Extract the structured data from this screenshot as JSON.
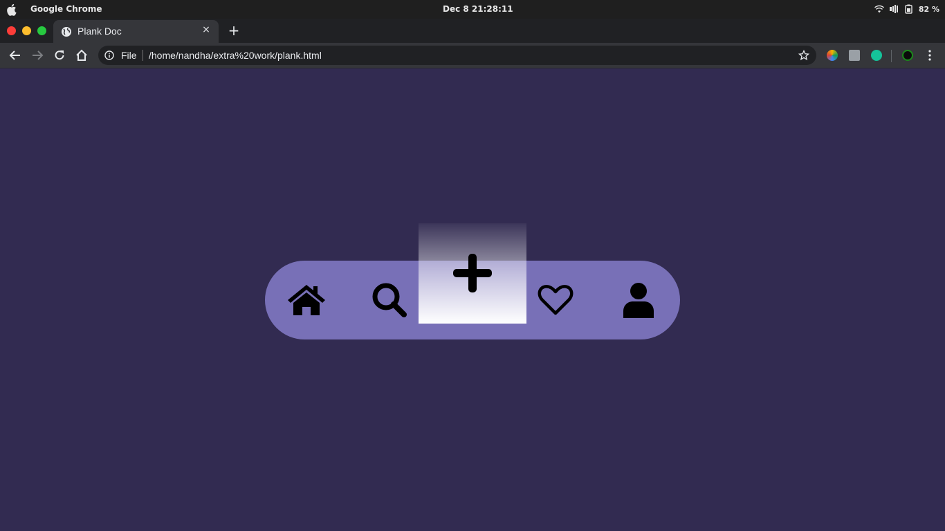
{
  "os": {
    "app_name": "Google Chrome",
    "clock": "Dec 8  21:28:11",
    "battery": "82 %",
    "icons": [
      "apple-icon",
      "wifi-icon",
      "volume-icon",
      "battery-icon"
    ]
  },
  "browser": {
    "tab": {
      "title": "Plank Doc",
      "favicon": "globe-icon",
      "close": "×"
    },
    "new_tab": "+",
    "omnibox": {
      "scheme_label": "File",
      "url": "/home/nandha/extra%20work/plank.html"
    },
    "extensions": [
      "color-picker-icon",
      "reader-icon",
      "grammarly-icon",
      "terminal-icon"
    ]
  },
  "page": {
    "background": "#322b51",
    "navbar": {
      "color": "#7870b7",
      "active_index": 2,
      "items": [
        {
          "icon": "home-icon",
          "active": false
        },
        {
          "icon": "search-icon",
          "active": false
        },
        {
          "icon": "plus-icon",
          "active": true
        },
        {
          "icon": "heart-icon",
          "active": false
        },
        {
          "icon": "user-icon",
          "active": false
        }
      ]
    }
  }
}
